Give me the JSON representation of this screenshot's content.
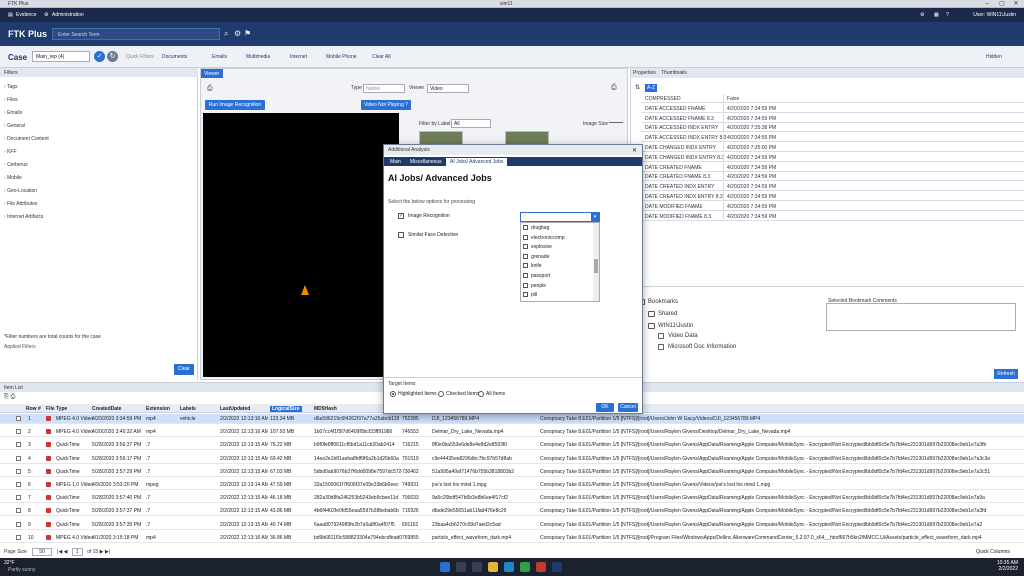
{
  "window": {
    "title": "FTK Plus",
    "center": "win11"
  },
  "menu": {
    "evidence": "Evidence",
    "administration": "Administration",
    "user": "User: WIN11\\Justin"
  },
  "app": {
    "logo": "FTK Plus",
    "search_placeholder": "Enter Search Term"
  },
  "casebar": {
    "case_label": "Case",
    "case_value": "Main_rep (4)",
    "quick_filters": "Quick Filters",
    "documents": "Documents",
    "emails": "Emails",
    "multimedia": "Multimedia",
    "internet": "Internet",
    "mobile_phone": "Mobile Phone",
    "clear_all": "Clear All",
    "hidden": "Hidden"
  },
  "filters": {
    "header": "Filters",
    "items": [
      "Tags",
      "Files",
      "Emails",
      "General",
      "Document Content",
      "KFF",
      "Cerberus",
      "Mobile",
      "Geo-Location",
      "File Attributes",
      "Internet Artifacts"
    ],
    "note": "*Filter numbers are total counts for the case",
    "applied": "Applied Filters",
    "clear": "Clear"
  },
  "viewer": {
    "tab": "Viewer",
    "run_btn": "Run Image Recognition",
    "video_btn": "Video Not Playing ?",
    "type_label": "Type",
    "type_value": "Native",
    "viewer_label": "Viewer",
    "viewer_value": "Video",
    "filter_label": "Filter by Label",
    "filter_value": "All",
    "image_size": "Image Size"
  },
  "properties": {
    "tabs": [
      "Properties",
      "Thumbnails"
    ],
    "az": "A-Z",
    "rows": [
      {
        "k": "COMPRESSED",
        "v": "False"
      },
      {
        "k": "DATE ACCESSED FNAME",
        "v": "4/20/2020 7:34:59 PM"
      },
      {
        "k": "DATE ACCESSED FNAME 8.3",
        "v": "4/20/2020 7:34:59 PM"
      },
      {
        "k": "DATE ACCESSED INDX ENTRY",
        "v": "4/20/2020 7:35:38 PM"
      },
      {
        "k": "DATE ACCESSED INDX ENTRY 8.3",
        "v": "4/20/2020 7:34:59 PM"
      },
      {
        "k": "DATE CHANGED INDX ENTRY",
        "v": "4/20/2020 7:35:00 PM"
      },
      {
        "k": "DATE CHANGED INDX ENTRY 8.3",
        "v": "4/20/2020 7:34:59 PM"
      },
      {
        "k": "DATE CREATED FNAME",
        "v": "4/20/2020 7:34:59 PM"
      },
      {
        "k": "DATE CREATED FNAME 8.3",
        "v": "4/20/2020 7:34:59 PM"
      },
      {
        "k": "DATE CREATED INDX ENTRY",
        "v": "4/20/2020 7:34:59 PM"
      },
      {
        "k": "DATE CREATED INDX ENTRY 8.3",
        "v": "4/20/2020 7:34:59 PM"
      },
      {
        "k": "DATE MODIFIED FNAME",
        "v": "4/20/2020 7:34:59 PM"
      },
      {
        "k": "DATE MODIFIED FNAME 8.3",
        "v": "4/20/2020 7:34:59 PM"
      }
    ]
  },
  "bookmarks": {
    "root": "Bookmarks",
    "shared": "Shared",
    "user": "WIN11\\Justin",
    "video": "Video Data",
    "doc": "Microsoft Doc Information",
    "comments": "Selected Bookmark Comments",
    "refresh": "Refresh"
  },
  "dialog": {
    "title": "Additional Analysis",
    "tabs": [
      "Main",
      "Miscellaneous",
      "AI Jobs/ Advanced Jobs"
    ],
    "heading": "AI Jobs/ Advanced Jobs",
    "sub": "Select the below options for processing",
    "image_rec": "Image Recognition",
    "face": "Similar Face Detection",
    "options": [
      "drugbag",
      "electroniccomp",
      "explosive",
      "grenade",
      "knife",
      "passport",
      "people",
      "pill"
    ],
    "target_group": "Target Items",
    "targets": [
      "Highlighted Items",
      "Checked Items",
      "All Items"
    ],
    "ok": "OK",
    "cancel": "Cancel"
  },
  "items": {
    "header": "Item List",
    "columns": [
      "Row #",
      "File Type",
      "CreatedDate",
      "Extension",
      "Labels",
      "LastUpdated",
      "LogicalSize",
      "MD5Hash"
    ],
    "rows": [
      {
        "n": "1",
        "type": "MPEG 4.0 Video",
        "created": "4/20/2020 3:34:59 PM",
        "ext": "mp4",
        "label": "vehicle",
        "upd": "2/2/2022 12:13:16 AM",
        "size": "123.34 MB",
        "md5": "d6a596219c6f4262f37a77a35abcb119",
        "id": "752285",
        "name": "DJI_123456789.MP4",
        "path": "Conspiracy Take 8.E01/Partition 1/5 [NTFS]/[root]/Users/John W Gacy/Videos/DJI_123456789.MP4"
      },
      {
        "n": "2",
        "type": "MPEG 4.0 Video",
        "created": "4/20/2020 3:40:32 AM",
        "ext": "mp4",
        "label": "",
        "upd": "2/2/2022 12:13:16 AM",
        "size": "107.93 MB",
        "md5": "1b07cc4f1f5f7d6409f0bcf33ff91986",
        "id": "746553",
        "name": "Delmar_Dry_Lake_Nevada.mp4",
        "path": "Conspiracy Take 8.E01/Partition 1/5 [NTFS]/[root]/Users/Raylen Givens/Desktop/Delmar_Dry_Lake_Nevada.mp4"
      },
      {
        "n": "3",
        "type": "QuickTime",
        "created": "5/28/2020 3:56:37 PM",
        "ext": ".7",
        "label": "",
        "upd": "2/2/2022 12:13:15 AM",
        "size": "76.22 MB",
        "md5": "b9f0fe8ff0611cf6bd1a11cb20ab2414",
        "id": "716215",
        "name": "8f0e0ba553e6de8e4e8d2e8593f0",
        "path": "Conspiracy Take 8.E01/Partition 1/5 [NTFS]/[root]/Users/Raylen Givens/AppData/Roaming/Apple Computer/MobileSync - Encrypted/Not Encrypted/bb9df0c5e7b7fd4ec231301d997b22008ec9eb1e7a3fb"
      },
      {
        "n": "4",
        "type": "QuickTime",
        "created": "5/28/2020 3:56:17 PM",
        "ext": ".7",
        "label": "",
        "upd": "2/2/2022 12:13:15 AM",
        "size": "69.42 MB",
        "md5": "14ee2e1b81aeba8fdf9f6a2b1d26b60a",
        "id": "701519",
        "name": "c9e44435ee8296dbc7bc97b57d8ab",
        "path": "Conspiracy Take 8.E01/Partition 1/5 [NTFS]/[root]/Users/Raylen Givens/AppData/Roaming/Apple Computer/MobileSync - Encrypted/Not Encrypted/bb9df0c5e7b7fd4ec231301d997b22008ec9eb1e7a3c3e"
      },
      {
        "n": "5",
        "type": "QuickTime",
        "created": "5/28/2020 3:57:29 PM",
        "ext": ".7",
        "label": "",
        "upd": "2/2/2022 12:13:15 AM",
        "size": "67.03 MB",
        "md5": "5dbd0ab9076b37f6dd0098e7597dc5724",
        "id": "730462",
        "name": "51a995a49af71476b755b3818803b2",
        "path": "Conspiracy Take 8.E01/Partition 1/5 [NTFS]/[root]/Users/Raylen Givens/AppData/Roaming/Apple Computer/MobileSync - Encrypted/Not Encrypted/bb9df0c5e7b7fd4ec231301d997b22008ec9eb1e7a3c51"
      },
      {
        "n": "6",
        "type": "MPEG 1.0 Video",
        "created": "4/9/2020 3:53:20 PM",
        "ext": "mpeg",
        "label": "",
        "upd": "2/2/2022 12:13:14 AM",
        "size": "47.59 MB",
        "md5": "33a1500061f7f606f37e09e33b6b0eec",
        "id": "749931",
        "name": "joe's lost his mind 1.mpg",
        "path": "Conspiracy Take 8.E01/Partition 1/5 [NTFS]/[root]/Users/Raylen Givens/Videos/joe's lost his mind 1.mpg"
      },
      {
        "n": "7",
        "type": "QuickTime",
        "created": "5/28/2020 3:57:40 PM",
        "ext": ".7",
        "label": "",
        "upd": "2/2/2022 12:13:15 AM",
        "size": "46.18 MB",
        "md5": "282a30d8fa246253b5243eb9cbee11d",
        "id": "706633",
        "name": "9a5c20bdf547b6b3e8b6ee4f17cf2",
        "path": "Conspiracy Take 8.E01/Partition 1/5 [NTFS]/[root]/Users/Raylen Givens/AppData/Roaming/Apple Computer/MobileSync - Encrypted/Not Encrypted/bb9df0c5e7b7fd4ec231301d997b22008ec9eb1e7a9a"
      },
      {
        "n": "8",
        "type": "QuickTime",
        "created": "5/28/2020 3:57:37 PM",
        "ext": ".7",
        "label": "",
        "upd": "2/2/2022 12:13:15 AM",
        "size": "43.86 MB",
        "md5": "4b6f4402fe0fd55eaa5597b38bebab6b",
        "id": "715926",
        "name": "dfade29e55651ab11fad476e8c29",
        "path": "Conspiracy Take 8.E01/Partition 1/5 [NTFS]/[root]/Users/Raylen Givens/AppData/Roaming/Apple Computer/MobileSync - Encrypted/Not Encrypted/bb9df0c5e7b7fd4ec231301d997b22008ec9eb1e7a3fd"
      },
      {
        "n": "9",
        "type": "QuickTime",
        "created": "5/28/2020 3:57:35 PM",
        "ext": ".7",
        "label": "",
        "upd": "2/2/2022 12:13:15 AM",
        "size": "40.74 MB",
        "md5": "6aaa807924989fe2b7a5a8f0a4f07f5",
        "id": "691162",
        "name": "23baa4cb6270c09d7aed2c5ad",
        "path": "Conspiracy Take 8.E01/Partition 1/5 [NTFS]/[root]/Users/Raylen Givens/AppData/Roaming/Apple Computer/MobileSync - Encrypted/Not Encrypted/bb9df0c5e7b7fd4ec231301d997b22008ec9eb1e7a2"
      },
      {
        "n": "10",
        "type": "MPEG 4.0 Video",
        "created": "4/1/2020 3:15:18 PM",
        "ext": "mp4",
        "label": "",
        "upd": "2/2/2022 12:13:16 AM",
        "size": "36.86 MB",
        "md5": "bd9b6811f3c588823304a794ebcdfead0",
        "id": "769855",
        "name": "particle_effect_waveform_dark.mp4",
        "path": "Conspiracy Take 8.E01/Partition 1/5 [NTFS]/[root]/Program Files/WindowsApps/Dellinc.AlienwareCommandCenter_5.2.97.0_x64__htrsf667h5kn2/MMCC.Ui/Assets/particle_effect_waveform_dark.mp4"
      }
    ],
    "pager": {
      "prefix": "Page Size",
      "size": "50",
      "page": "1",
      "of": "of 15"
    },
    "quick_columns": "Quick Columns"
  },
  "taskbar": {
    "weather": "32°F",
    "weather_sub": "Partly sunny",
    "time": "10:35 AM",
    "date": "2/2/2022"
  }
}
